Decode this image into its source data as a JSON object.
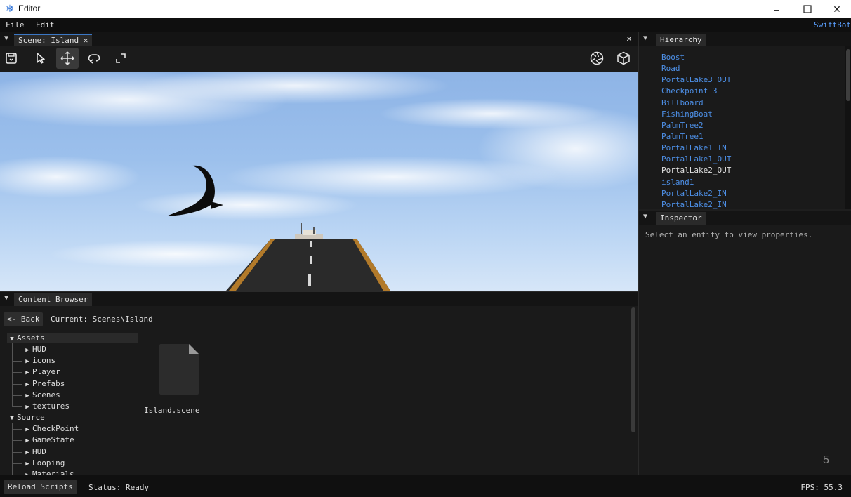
{
  "window": {
    "title": "Editor",
    "icon": "snowflake-icon",
    "controls": [
      "minimize-icon",
      "maximize-icon",
      "close-icon"
    ]
  },
  "menubar": {
    "items": [
      "File",
      "Edit"
    ],
    "brand": "SwiftBot"
  },
  "scene": {
    "tab_label": "Scene: Island",
    "tab_close": "✕",
    "panel_close": "✕",
    "toolbar": [
      "save-icon",
      "select-pointer-icon",
      "move-icon",
      "rotate-icon",
      "scale-icon"
    ],
    "toolbar_selected": "move-icon",
    "toolbar_right": [
      "camera-aperture-icon",
      "cube-icon"
    ]
  },
  "hierarchy": {
    "title": "Hierarchy",
    "items": [
      {
        "label": "Boost",
        "highlighted": true
      },
      {
        "label": "Road",
        "highlighted": true
      },
      {
        "label": "PortalLake3_OUT",
        "highlighted": true
      },
      {
        "label": "Checkpoint_3",
        "highlighted": true
      },
      {
        "label": "Billboard",
        "highlighted": true
      },
      {
        "label": "FishingBoat",
        "highlighted": true
      },
      {
        "label": "PalmTree2",
        "highlighted": true
      },
      {
        "label": "PalmTree1",
        "highlighted": true
      },
      {
        "label": "PortalLake1_IN",
        "highlighted": true
      },
      {
        "label": "PortalLake1_OUT",
        "highlighted": true
      },
      {
        "label": "PortalLake2_OUT",
        "highlighted": false
      },
      {
        "label": "island1",
        "highlighted": true
      },
      {
        "label": "PortalLake2_IN",
        "highlighted": true
      },
      {
        "label": "PortalLake2_IN",
        "highlighted": true
      }
    ]
  },
  "inspector": {
    "title": "Inspector",
    "hint": "Select an entity to view properties."
  },
  "content_browser": {
    "title": "Content Browser",
    "back_label": "<- Back",
    "current_path": "Current: Scenes\\Island",
    "tree": [
      {
        "label": "Assets",
        "level": 0,
        "expanded": true
      },
      {
        "label": "HUD",
        "level": 1,
        "expanded": false
      },
      {
        "label": "icons",
        "level": 1,
        "expanded": false
      },
      {
        "label": "Player",
        "level": 1,
        "expanded": false
      },
      {
        "label": "Prefabs",
        "level": 1,
        "expanded": false
      },
      {
        "label": "Scenes",
        "level": 1,
        "expanded": false
      },
      {
        "label": "textures",
        "level": 1,
        "expanded": false
      },
      {
        "label": "Source",
        "level": 0,
        "expanded": true
      },
      {
        "label": "CheckPoint",
        "level": 1,
        "expanded": false
      },
      {
        "label": "GameState",
        "level": 1,
        "expanded": false
      },
      {
        "label": "HUD",
        "level": 1,
        "expanded": false
      },
      {
        "label": "Looping",
        "level": 1,
        "expanded": false
      },
      {
        "label": "Materials",
        "level": 1,
        "expanded": false
      }
    ],
    "files": [
      {
        "label": "Island.scene",
        "icon": "file-icon"
      }
    ]
  },
  "statusbar": {
    "reload_label": "Reload Scripts",
    "status": "Status: Ready",
    "fps": "FPS: 55.3"
  },
  "corner_number": "5"
}
